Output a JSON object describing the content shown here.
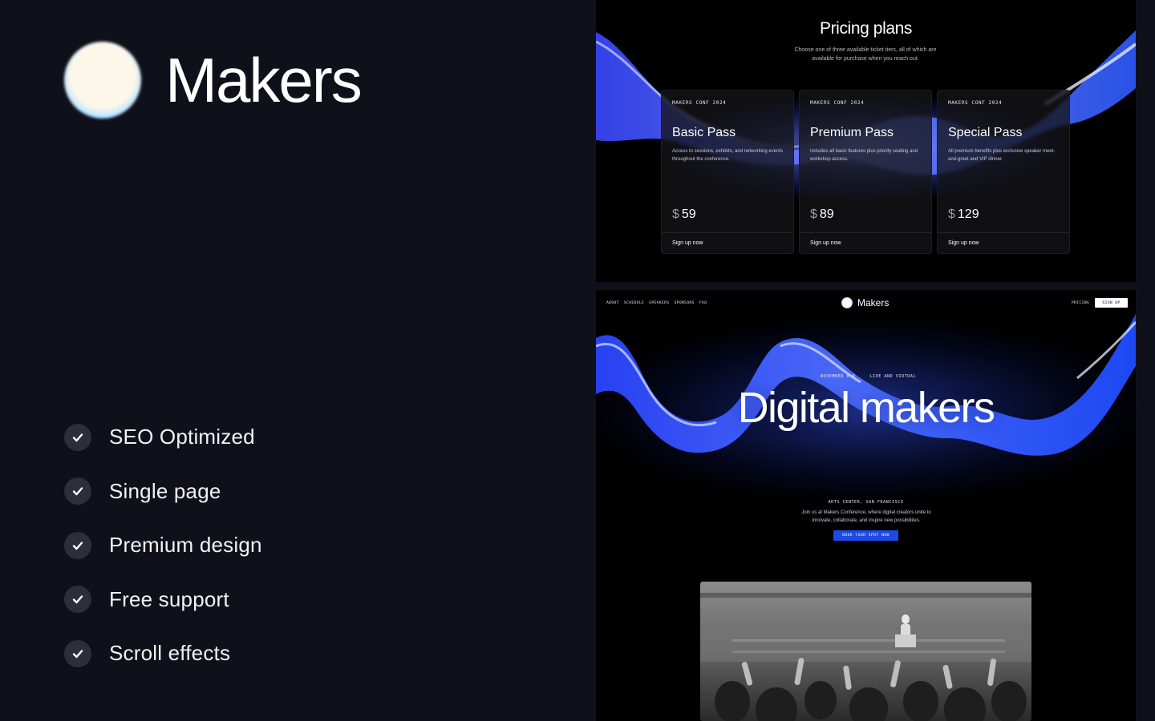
{
  "brand": {
    "name": "Makers"
  },
  "features": [
    {
      "label": "SEO Optimized",
      "icon": "check-icon"
    },
    {
      "label": "Single page",
      "icon": "check-icon"
    },
    {
      "label": "Premium design",
      "icon": "check-icon"
    },
    {
      "label": "Free support",
      "icon": "check-icon"
    },
    {
      "label": "Scroll effects",
      "icon": "check-icon"
    }
  ],
  "pricing": {
    "title": "Pricing plans",
    "subtitle": "Choose one of three available ticket tiers, all of which are available for purchase when you reach out.",
    "plans": [
      {
        "tag": "MAKERS CONF 2024",
        "name": "Basic Pass",
        "description": "Access to sessions, exhibits, and networking events throughout the conference.",
        "currency": "$",
        "price": "59",
        "cta": "Sign up now"
      },
      {
        "tag": "MAKERS CONF 2024",
        "name": "Premium Pass",
        "description": "Includes all basic features plus priority seating and workshop access.",
        "currency": "$",
        "price": "89",
        "cta": "Sign up now"
      },
      {
        "tag": "MAKERS CONF 2024",
        "name": "Special Pass",
        "description": "All premium benefits plus exclusive speaker meet-and-greet and VIP dinner.",
        "currency": "$",
        "price": "129",
        "cta": "Sign up now"
      }
    ]
  },
  "site": {
    "nav": {
      "links": [
        "ABOUT",
        "SCHEDULE",
        "SPEAKERS",
        "SPONSORS",
        "FAQ"
      ],
      "logo_text": "Makers",
      "pricing_link": "PRICING",
      "signup_button": "SIGN UP"
    },
    "hero": {
      "meta": "NOVEMBER 8-9     LIVE AND VIRTUAL",
      "title": "Digital makers",
      "location": "ARTS CENTER, SAN FRANCISCO",
      "description": "Join us at Makers Conference, where digital creators unite to innovate, collaborate, and inspire new possibilities.",
      "cta": "BOOK YOUR SPOT NOW"
    }
  },
  "colors": {
    "page_bg": "#0f111a",
    "panel_bg": "#000000",
    "accent_blue": "#1f49e6",
    "ribbon_blue": "#2f5bff",
    "check_bg": "#2c2f3a"
  }
}
